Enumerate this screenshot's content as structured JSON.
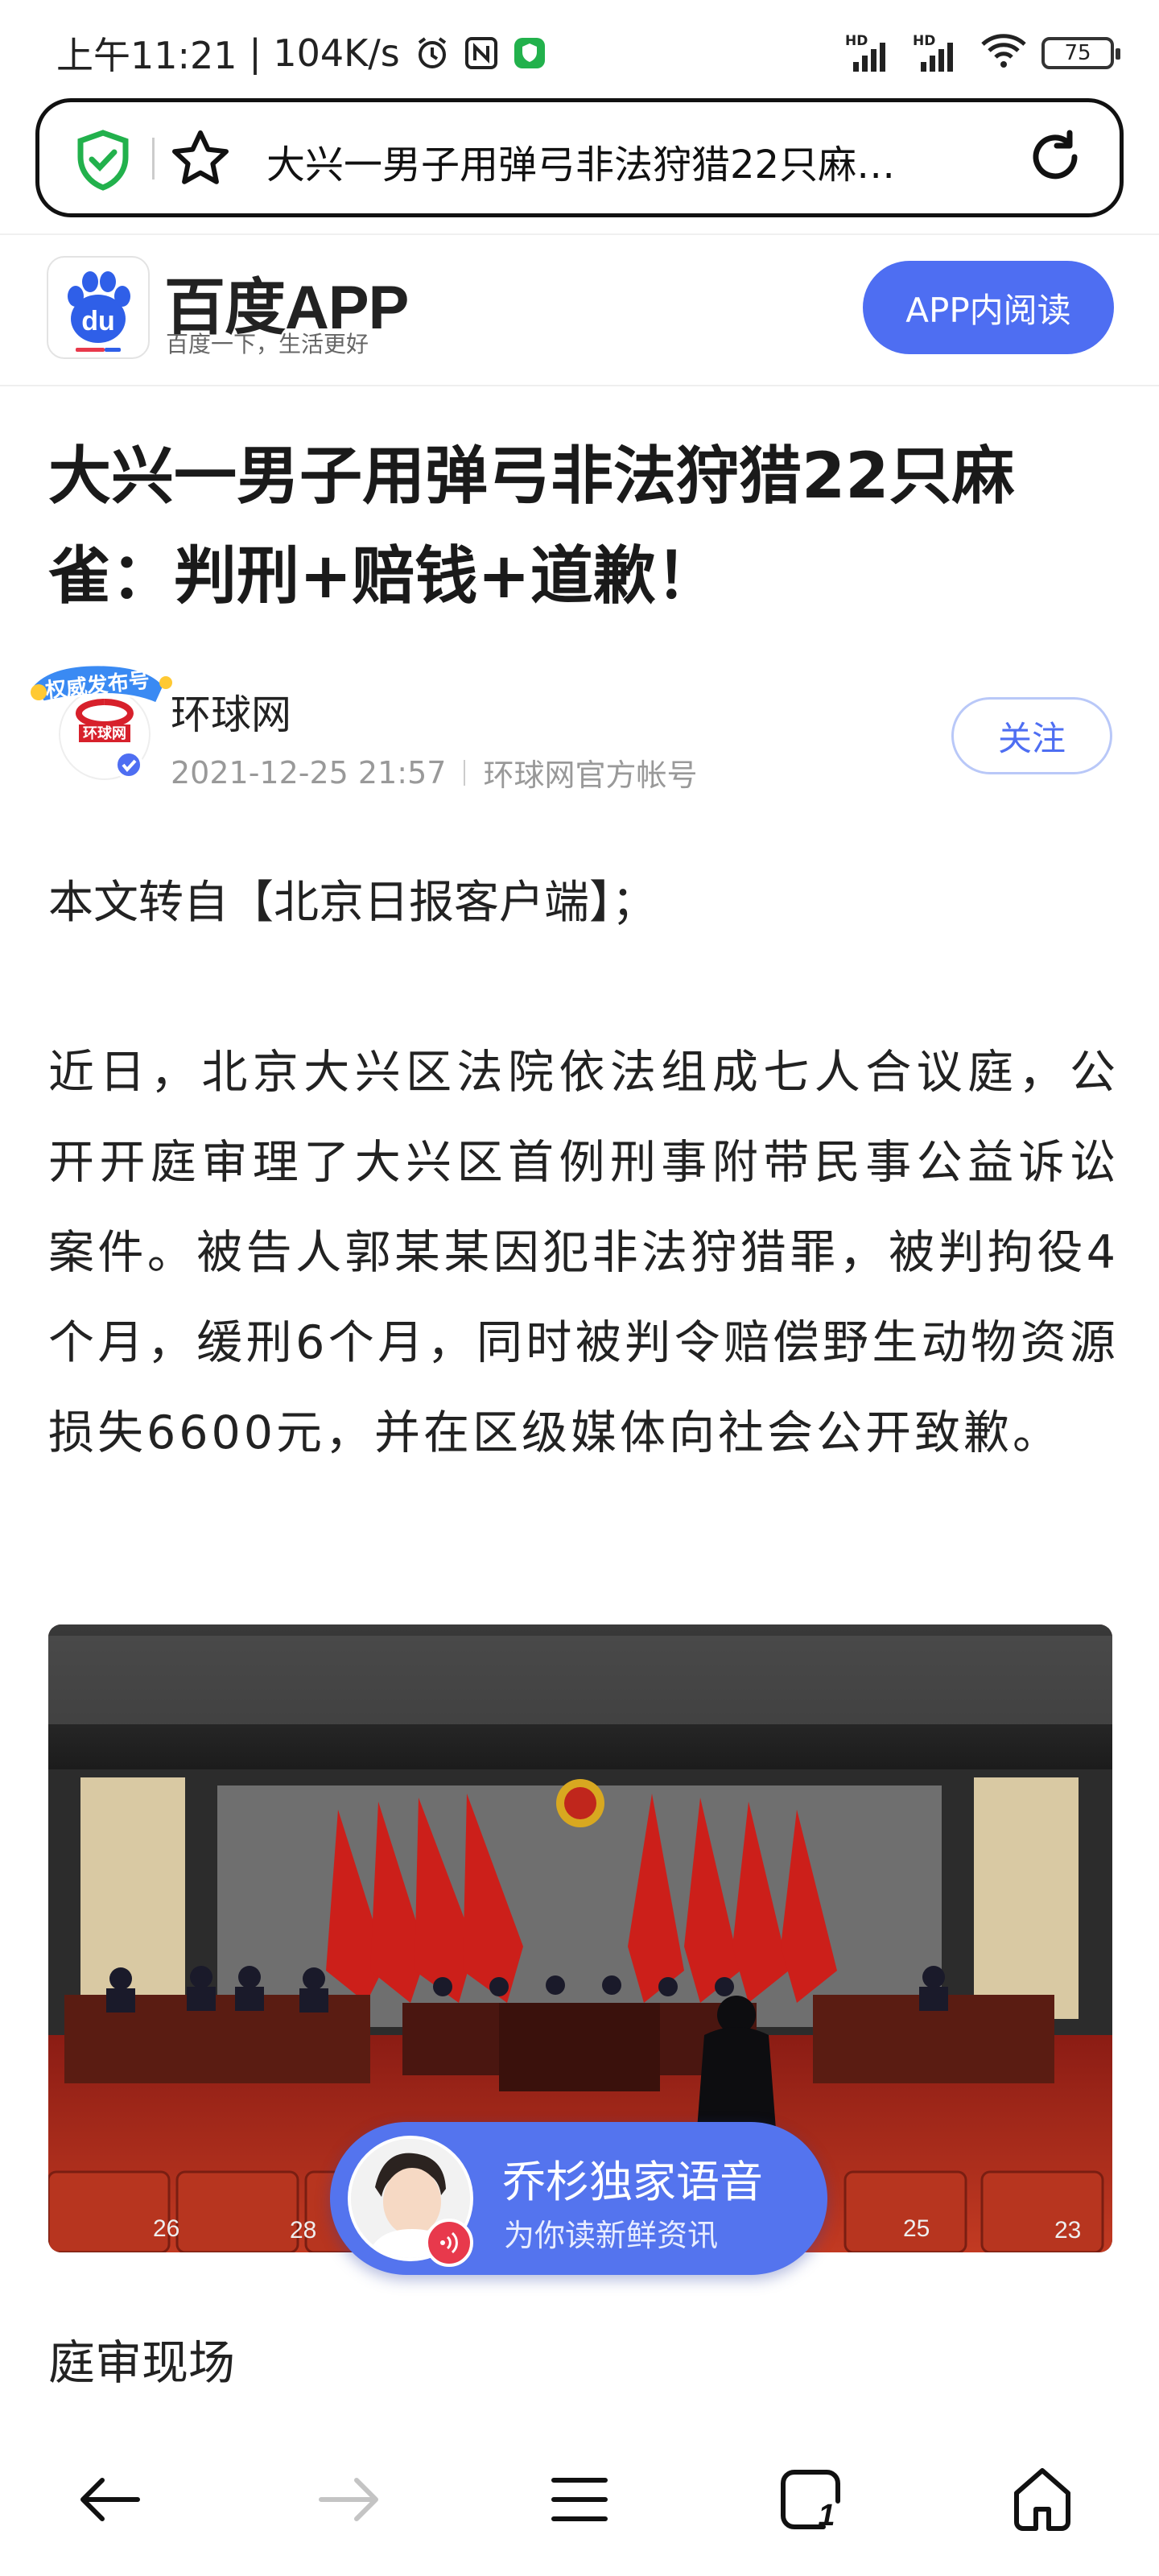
{
  "status_bar": {
    "time": "上午11:21",
    "speed": "104K/s",
    "battery": "75",
    "signal_label": "HD",
    "icons": [
      "alarm-icon",
      "nfc-icon",
      "shield-app-icon",
      "signal-icon",
      "wifi-icon",
      "battery-icon"
    ]
  },
  "browser": {
    "url_title": "大兴一男子用弹弓非法狩猎22只麻…",
    "icons": [
      "shield-check-icon",
      "star-icon",
      "reload-icon"
    ],
    "accent": "#22b14c"
  },
  "app_header": {
    "logo_text": "du",
    "app_name": "百度APP",
    "slogan": "百度一下，生活更好",
    "read_button": "APP内阅读",
    "brand_color": "#4e6ef2"
  },
  "article": {
    "title": "大兴一男子用弹弓非法狩猎22只麻雀：判刑+赔钱+道歉！",
    "author": {
      "name": "环球网",
      "date": "2021-12-25 21:57",
      "account": "环球网官方帐号",
      "badge_text": "权威发布号",
      "logo_text": "环球网",
      "follow_label": "关注"
    },
    "paragraphs": [
      "本文转自【北京日报客户端】；",
      "近日，北京大兴区法院依法组成七人合议庭，公开开庭审理了大兴区首例刑事附带民事公益诉讼案件。被告人郭某某因犯非法狩猎罪，被判拘役4个月，缓刑6个月，同时被判令赔偿野生动物资源损失6600元，并在区级媒体向社会公开致歉。"
    ],
    "image_seat_numbers": [
      "26",
      "28",
      "25",
      "23"
    ],
    "caption": "庭审现场"
  },
  "audio_player": {
    "title": "乔杉独家语音",
    "subtitle": "为你读新鲜资讯"
  },
  "bottom_nav": {
    "items": [
      "back-icon",
      "forward-icon",
      "menu-icon",
      "tabs-icon",
      "home-icon"
    ],
    "tabs_count": "1"
  }
}
